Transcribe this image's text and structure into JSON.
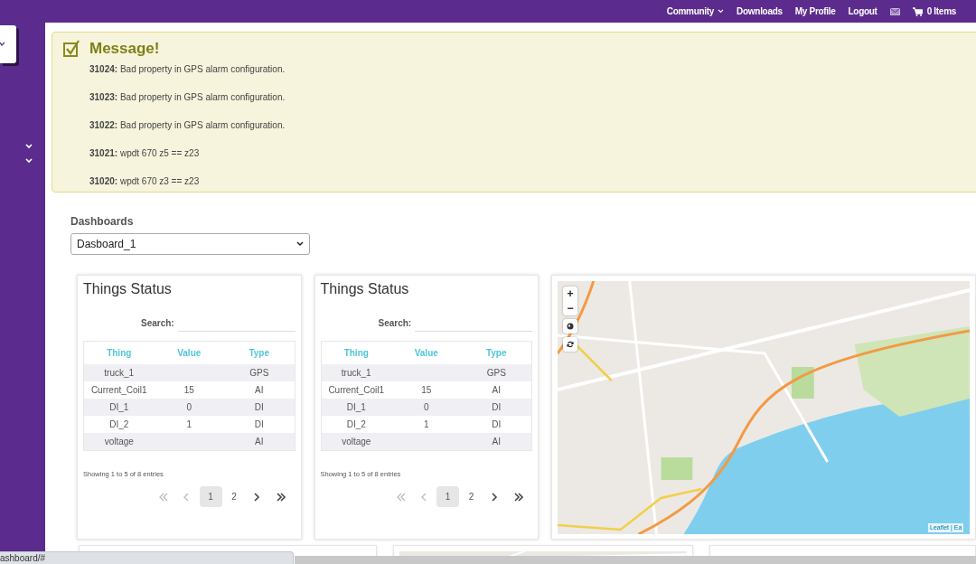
{
  "top_nav": [
    {
      "label": "Community",
      "kind": "dropdown"
    },
    {
      "label": "Downloads",
      "kind": "link"
    },
    {
      "label": "My Profile",
      "kind": "link"
    },
    {
      "label": "Logout",
      "kind": "link"
    },
    {
      "kind": "mail"
    },
    {
      "label": "0 Items",
      "kind": "cart"
    }
  ],
  "message": {
    "title": "Message!",
    "entries": [
      {
        "text": "**31024:** Bad property in GPS alarm configuration."
      },
      {
        "text": "**31023:** Bad property in GPS alarm configuration."
      },
      {
        "text": "**31022:** Bad property in GPS alarm configuration."
      },
      {
        "text": "**31021:** wpdt 670 z5 == z23"
      },
      {
        "text": "**31020:** wpdt 670 z3 == z23"
      }
    ]
  },
  "dashboards": {
    "label": "Dashboards",
    "value": "Dasboard_1"
  },
  "cards": [
    {
      "kind": "table",
      "title": "Things Status",
      "search_label": "Search:",
      "columns": [
        "Thing",
        "Value",
        "Type"
      ],
      "rows": [
        [
          "truck_1",
          "",
          "GPS"
        ],
        [
          "Current_Coil1",
          "15",
          "AI"
        ],
        [
          "DI_1",
          "0",
          "DI"
        ],
        [
          "DI_2",
          "1",
          "DI"
        ],
        [
          "voltage",
          "",
          "AI"
        ]
      ],
      "info": "Showing 1 to 5 of 8 entries",
      "pagination": [
        {
          "kind": "first",
          "selected": false
        },
        {
          "kind": "prev",
          "selected": false
        },
        {
          "kind": "page",
          "label": "1",
          "selected": true
        },
        {
          "kind": "page",
          "label": "2",
          "selected": false
        },
        {
          "kind": "next",
          "selected": false
        },
        {
          "kind": "last",
          "selected": false
        }
      ]
    },
    {
      "kind": "table",
      "title": "Things Status",
      "search_label": "Search:",
      "columns": [
        "Thing",
        "Value",
        "Type"
      ],
      "rows": [
        [
          "truck_1",
          "",
          "GPS"
        ],
        [
          "Current_Coil1",
          "15",
          "AI"
        ],
        [
          "DI_1",
          "0",
          "DI"
        ],
        [
          "DI_2",
          "1",
          "DI"
        ],
        [
          "voltage",
          "",
          "AI"
        ]
      ],
      "info": "Showing 1 to 5 of 8 entries",
      "pagination": [
        {
          "kind": "first",
          "selected": false
        },
        {
          "kind": "prev",
          "selected": false
        },
        {
          "kind": "page",
          "label": "1",
          "selected": true
        },
        {
          "kind": "page",
          "label": "2",
          "selected": false
        },
        {
          "kind": "next",
          "selected": false
        },
        {
          "kind": "last",
          "selected": false
        }
      ]
    },
    {
      "kind": "map",
      "controls": [
        "+",
        "−"
      ],
      "attribution": "Leaflet | Ea"
    }
  ],
  "status_bar": {
    "url": "ashboard/#"
  }
}
